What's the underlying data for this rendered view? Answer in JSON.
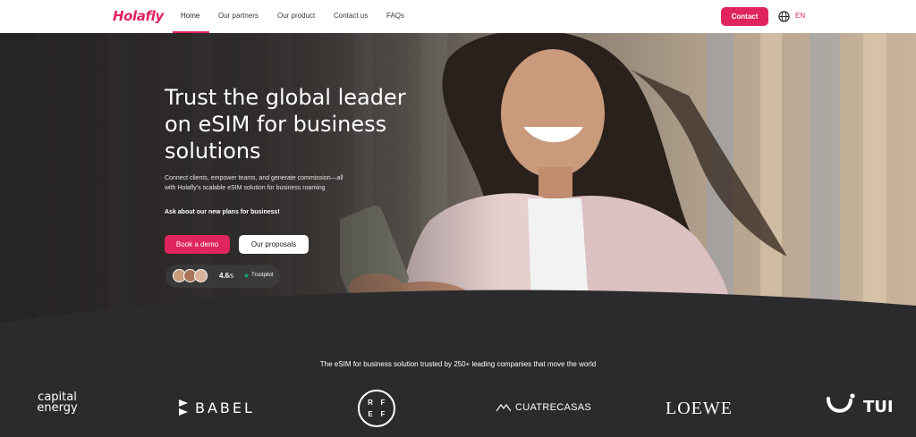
{
  "nav": {
    "logo": "Holafly",
    "links": [
      "Home",
      "Our partners",
      "Our product",
      "Contact us",
      "FAQs"
    ],
    "contact_label": "Contact",
    "language": "EN"
  },
  "hero": {
    "title": "Trust the global leader on eSIM for business solutions",
    "subtitle": "Connect clients, empower teams, and generate commission—all with Holafly's scalable eSIM solution for business roaming",
    "ask": "Ask about our new plans for business!",
    "demo_label": "Book a demo",
    "proposals_label": "Our proposals",
    "rating": {
      "value": "4.6",
      "suffix": "/5",
      "source": "Trustpilot"
    }
  },
  "trusted": {
    "text": "The eSIM for business solution trusted by 250+ leading companies that move the world",
    "brands": {
      "capital_line1": "capital",
      "capital_line2": "energy",
      "babel": "BABEL",
      "rfef": [
        "R",
        "F",
        "E",
        "F"
      ],
      "cuatrecasas": "CUATRECASAS",
      "loewe": "LOEWE",
      "tui": "TUI"
    }
  },
  "colors": {
    "accent": "#e0245e",
    "dark_bg": "#2b2b2e",
    "trustpilot_green": "#00b67a"
  }
}
